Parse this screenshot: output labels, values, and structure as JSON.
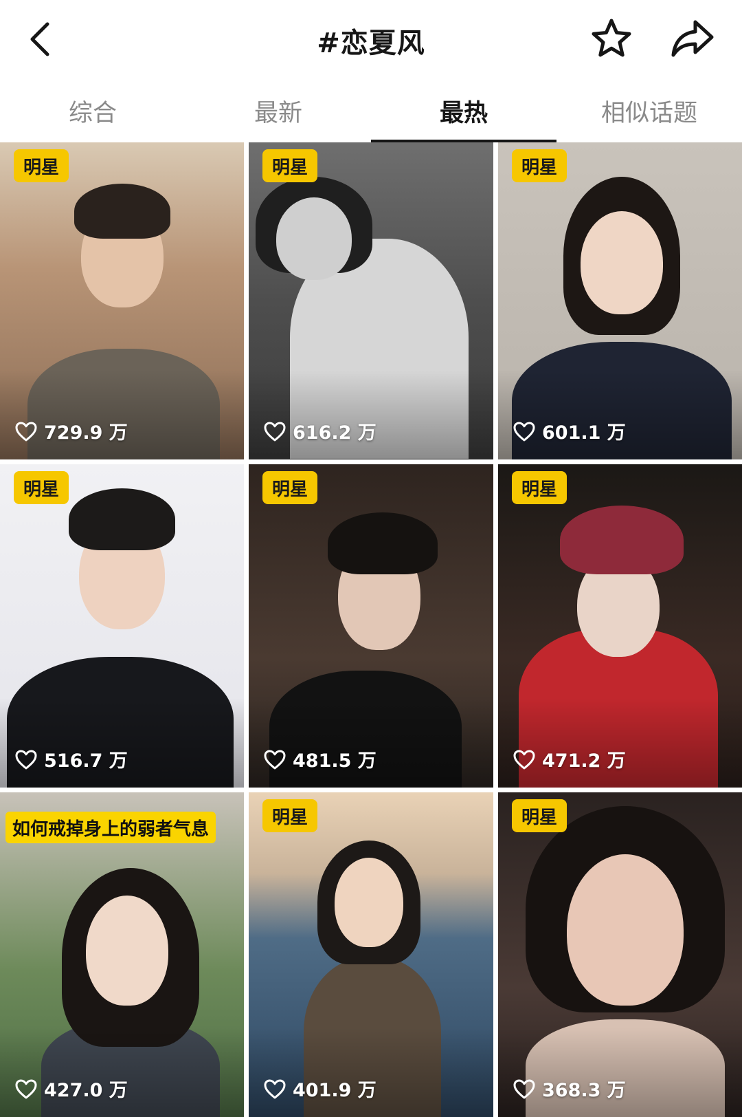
{
  "header": {
    "title": "#恋夏风"
  },
  "tabs": [
    {
      "label": "综合",
      "active": false
    },
    {
      "label": "最新",
      "active": false
    },
    {
      "label": "最热",
      "active": true
    },
    {
      "label": "相似话题",
      "active": false
    }
  ],
  "videos": [
    {
      "badge": "明星",
      "likes": "729.9 万"
    },
    {
      "badge": "明星",
      "likes": "616.2 万"
    },
    {
      "badge": "明星",
      "likes": "601.1 万"
    },
    {
      "badge": "明星",
      "likes": "516.7 万"
    },
    {
      "badge": "明星",
      "likes": "481.5 万"
    },
    {
      "badge": "明星",
      "likes": "471.2 万"
    },
    {
      "banner": "如何戒掉身上的弱者气息",
      "likes": "427.0 万"
    },
    {
      "badge": "明星",
      "likes": "401.9 万"
    },
    {
      "badge": "明星",
      "likes": "368.3 万"
    }
  ],
  "colors": {
    "badge": "#f6c700",
    "active_tab": "#161616",
    "inactive_tab": "#8a8a8a"
  }
}
